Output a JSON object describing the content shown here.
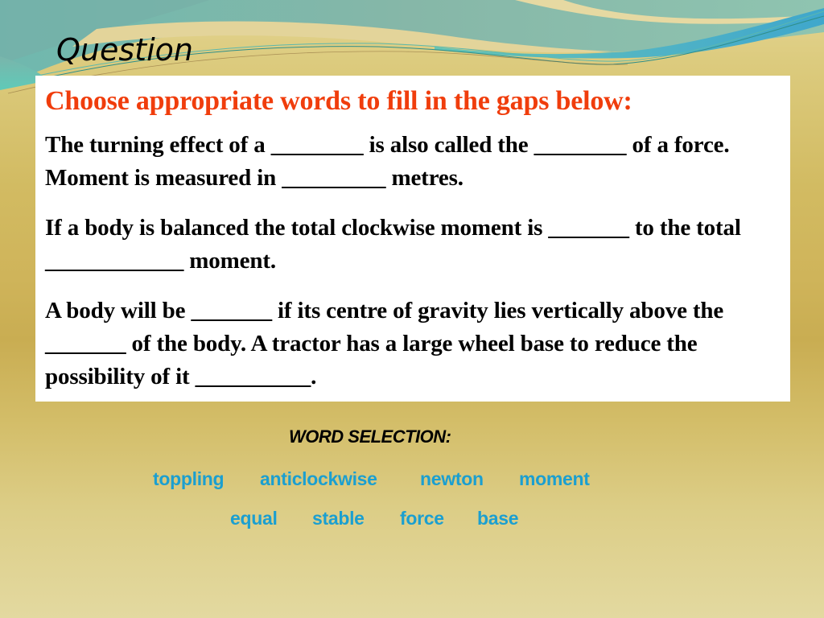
{
  "slide": {
    "title": "Question"
  },
  "content": {
    "instruction": "Choose appropriate words to fill in the gaps below:",
    "paragraphs": [
      "The turning effect of a ________ is also called the ________ of a force. Moment is measured in _________ metres.",
      "If a body is balanced the total clockwise moment is _______ to the total ____________ moment.",
      "A body will be _______ if its centre of gravity lies vertically above the _______ of the body. A tractor has a large wheel base to reduce the possibility of it __________."
    ]
  },
  "word_selection": {
    "heading": "WORD SELECTION:",
    "row1": [
      "toppling",
      "anticlockwise",
      "newton",
      "moment"
    ],
    "row2": [
      "equal",
      "stable",
      "force",
      "base"
    ]
  },
  "colors": {
    "instruction": "#f03d0c",
    "word": "#1b9fd0",
    "body_text": "#000000",
    "box_background": "#ffffff"
  }
}
